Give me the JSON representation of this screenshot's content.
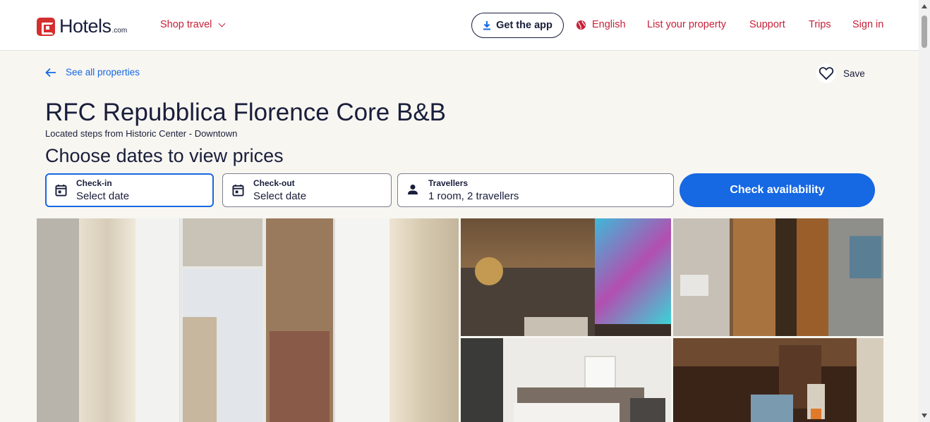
{
  "header": {
    "logo_text": "Hotels",
    "logo_suffix": ".com",
    "shop_travel": "Shop travel",
    "get_app": "Get the app",
    "language": "English",
    "list_property": "List your property",
    "support": "Support",
    "trips": "Trips",
    "sign_in": "Sign in"
  },
  "nav": {
    "back_label": "See all properties",
    "save_label": "Save"
  },
  "property": {
    "name": "RFC Repubblica Florence Core B&B",
    "location": "Located steps from Historic Center - Downtown"
  },
  "search": {
    "heading": "Choose dates to view prices",
    "checkin_label": "Check-in",
    "checkin_value": "Select date",
    "checkout_label": "Check-out",
    "checkout_value": "Select date",
    "travellers_label": "Travellers",
    "travellers_value": "1 room, 2 travellers",
    "submit_label": "Check availability"
  },
  "colors": {
    "brand_red": "#c62139",
    "primary_blue": "#1668e3",
    "text_dark": "#191e3b",
    "page_bg": "#f8f6f1"
  },
  "icons": [
    "download-icon",
    "globe-icon",
    "arrow-left-icon",
    "heart-icon",
    "calendar-icon",
    "person-icon",
    "chevron-down-icon"
  ]
}
